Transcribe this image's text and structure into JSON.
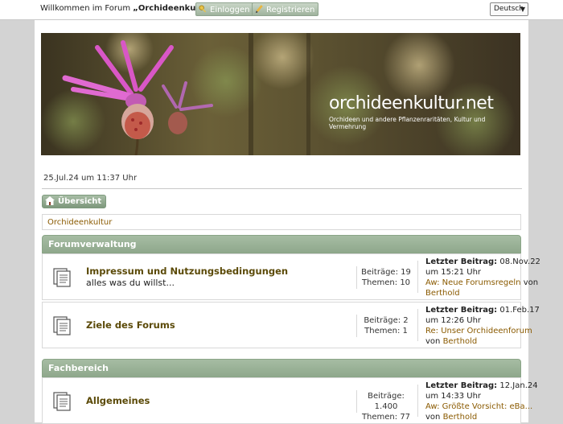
{
  "topbar": {
    "welcome_prefix": "Willkommen im Forum ",
    "welcome_name": "„Orchideenkultur“",
    "welcome_suffix": ".",
    "login_label": "Einloggen",
    "register_label": "Registrieren",
    "language": "Deutsch"
  },
  "banner": {
    "title": "orchideenkultur.net",
    "subtitle": "Orchideen und andere Pflanzenraritäten, Kultur und Vermehrung"
  },
  "date_line": "25.Jul.24 um 11:37 Uhr",
  "nav": {
    "overview_label": "Übersicht"
  },
  "breadcrumb": "Orchideenkultur",
  "categories": [
    {
      "title": "Forumverwaltung",
      "forums": [
        {
          "name": "Impressum und Nutzungsbedingungen",
          "description": "alles was du willst...",
          "posts": "Beiträge: 19",
          "topics": "Themen: 10",
          "last_label": "Letzter Beitrag:",
          "last_date": "08.Nov.22",
          "last_time": "um 15:21 Uhr",
          "last_topic": "Aw: Neue Forumsregeln",
          "last_by": "von",
          "last_user": "Berthold"
        },
        {
          "name": "Ziele des Forums",
          "description": "",
          "posts": "Beiträge: 2",
          "topics": "Themen: 1",
          "last_label": "Letzter Beitrag:",
          "last_date": "01.Feb.17",
          "last_time": "um 12:26 Uhr",
          "last_topic": "Re: Unser Orchideenforum",
          "last_by": "von",
          "last_user": "Berthold"
        }
      ]
    },
    {
      "title": "Fachbereich",
      "forums": [
        {
          "name": "Allgemeines",
          "description": "",
          "posts": "Beiträge: 1.400",
          "topics": "Themen: 77",
          "last_label": "Letzter Beitrag:",
          "last_date": "12.Jan.24",
          "last_time": "um 14:33 Uhr",
          "last_topic": "Aw: Größte Vorsicht: eBa...",
          "last_by": "von",
          "last_user": "Berthold"
        }
      ]
    }
  ]
}
